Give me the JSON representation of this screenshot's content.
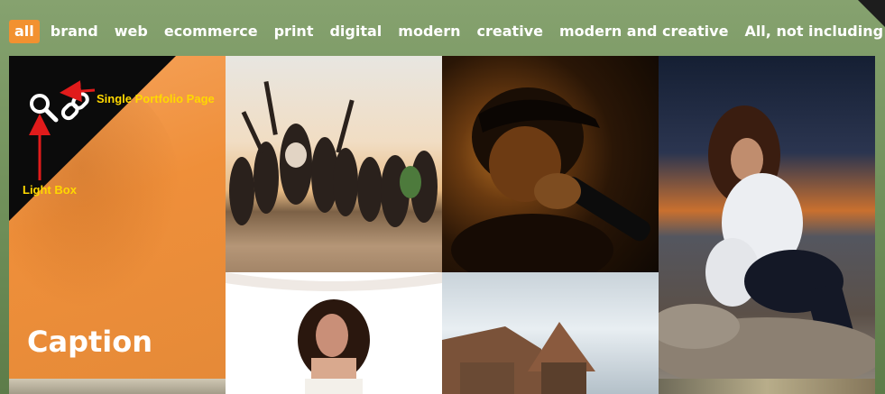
{
  "filters": [
    {
      "label": "all",
      "active": true
    },
    {
      "label": "brand"
    },
    {
      "label": "web"
    },
    {
      "label": "ecommerce"
    },
    {
      "label": "print"
    },
    {
      "label": "digital"
    },
    {
      "label": "modern"
    },
    {
      "label": "creative"
    },
    {
      "label": "modern and creative"
    },
    {
      "label": "All, not including web"
    }
  ],
  "hover_tile": {
    "caption": "Caption",
    "icons": [
      "search-icon",
      "link-icon"
    ]
  },
  "annotations": {
    "single_portfolio": "Single Portfolio Page",
    "light_box": "Light Box"
  },
  "colors": {
    "accent": "#f29130",
    "annotation_text": "#ffd800",
    "annotation_arrow": "#e11b1b",
    "overlay": "#0b0b0b"
  }
}
